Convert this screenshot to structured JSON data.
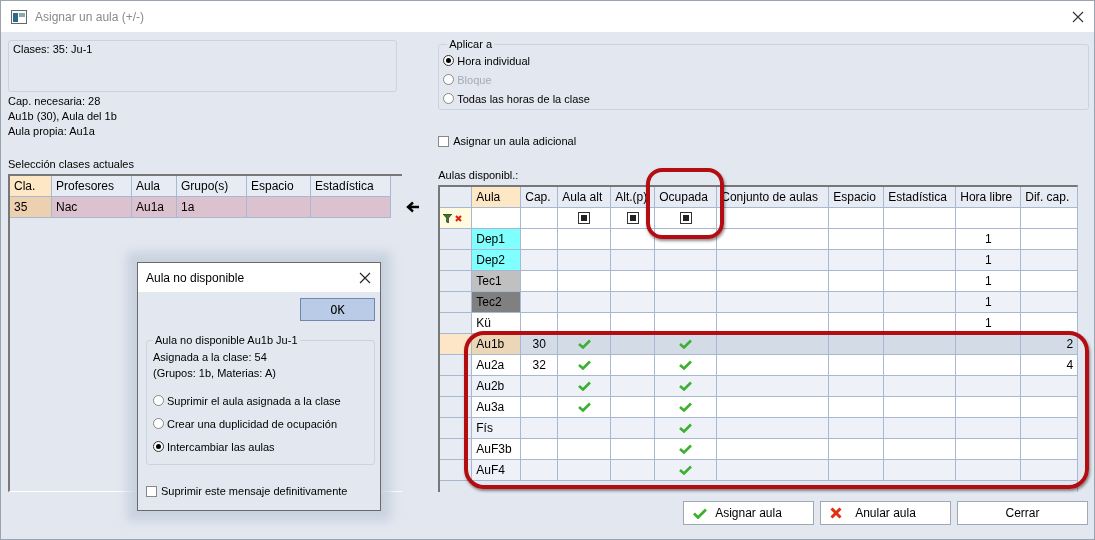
{
  "window": {
    "title": "Asignar un aula (+/-)"
  },
  "class_info": "Clases: 35: Ju-1",
  "info_lines": [
    "Cap. necesaria: 28",
    "Au1b (30), Aula del 1b",
    "Aula propia: Au1a"
  ],
  "current_classes": {
    "label": "Selección clases actuales",
    "columns": [
      "Cla.",
      "Profesores",
      "Aula",
      "Grupo(s)",
      "Espacio",
      "Estadística"
    ],
    "rows": [
      {
        "selected": true,
        "cells": [
          "35",
          "Nac",
          "Au1a",
          "1a",
          null,
          null
        ]
      }
    ]
  },
  "apply_to": {
    "legend": "Aplicar a",
    "options": [
      {
        "label": "Hora individual",
        "selected": true,
        "disabled": false
      },
      {
        "label": "Bloque",
        "selected": false,
        "disabled": true
      },
      {
        "label": "Todas las horas de la clase",
        "selected": false,
        "disabled": false
      }
    ]
  },
  "extra_room": {
    "label": "Asignar un aula adicional",
    "checked": false
  },
  "available_rooms": {
    "label": "Aulas disponibl.:",
    "columns": [
      {
        "label": "Aula",
        "kind": "text"
      },
      {
        "label": "Cap.",
        "kind": "center"
      },
      {
        "label": "Aula alt",
        "kind": "check",
        "filter_box": true
      },
      {
        "label": "Alt.(p)",
        "kind": "check",
        "filter_box": true
      },
      {
        "label": "Ocupada",
        "kind": "check",
        "filter_box": true
      },
      {
        "label": "Conjunto de aulas",
        "kind": "text"
      },
      {
        "label": "Espacio",
        "kind": "text"
      },
      {
        "label": "Estadística",
        "kind": "text"
      },
      {
        "label": "Hora libre",
        "kind": "center"
      },
      {
        "label": "Dif. cap.",
        "kind": "right"
      }
    ],
    "rows": [
      {
        "selected": false,
        "color": "#80ffff",
        "cells": [
          "Dep1",
          null,
          false,
          false,
          false,
          null,
          null,
          null,
          "1",
          null
        ]
      },
      {
        "selected": false,
        "color": "#80ffff",
        "cells": [
          "Dep2",
          null,
          false,
          false,
          false,
          null,
          null,
          null,
          "1",
          null
        ]
      },
      {
        "selected": false,
        "color": "#c0c0c0",
        "cells": [
          "Tec1",
          null,
          false,
          false,
          false,
          null,
          null,
          null,
          "1",
          null
        ]
      },
      {
        "selected": false,
        "color": "#808080",
        "cells": [
          "Tec2",
          null,
          false,
          false,
          false,
          null,
          null,
          null,
          "1",
          null
        ]
      },
      {
        "selected": false,
        "cells": [
          "Kü",
          null,
          false,
          false,
          false,
          null,
          null,
          null,
          "1",
          null
        ]
      },
      {
        "selected": true,
        "cells": [
          "Au1b",
          "30",
          true,
          false,
          true,
          null,
          null,
          null,
          null,
          "2"
        ]
      },
      {
        "selected": false,
        "cells": [
          "Au2a",
          "32",
          true,
          false,
          true,
          null,
          null,
          null,
          null,
          "4"
        ]
      },
      {
        "selected": false,
        "cells": [
          "Au2b",
          null,
          true,
          false,
          true,
          null,
          null,
          null,
          null,
          null
        ]
      },
      {
        "selected": false,
        "cells": [
          "Au3a",
          null,
          true,
          false,
          true,
          null,
          null,
          null,
          null,
          null
        ]
      },
      {
        "selected": false,
        "cells": [
          "Fís",
          null,
          false,
          false,
          true,
          null,
          null,
          null,
          null,
          null
        ]
      },
      {
        "selected": false,
        "cells": [
          "AuF3b",
          null,
          false,
          false,
          true,
          null,
          null,
          null,
          null,
          null
        ]
      },
      {
        "selected": false,
        "cells": [
          "AuF4",
          null,
          false,
          false,
          true,
          null,
          null,
          null,
          null,
          null
        ]
      }
    ]
  },
  "buttons": [
    {
      "label": "Asignar aula",
      "kind": "ok"
    },
    {
      "label": "Anular aula",
      "kind": "cancel"
    },
    {
      "label": "Cerrar",
      "kind": "plain"
    }
  ],
  "dialog": {
    "title": "Aula no disponible",
    "ok": "OK",
    "legend": "Aula no disponible  Au1b  Ju-1",
    "lines": [
      "Asignada a la clase: 54",
      "(Grupos: 1b, Materias: A)"
    ],
    "options": [
      {
        "label": "Suprimir el aula asignada a la clase",
        "selected": false
      },
      {
        "label": "Crear una duplicidad de ocupación",
        "selected": false
      },
      {
        "label": "Intercambiar las aulas",
        "selected": true
      }
    ],
    "suppress": {
      "label": "Suprimir este mensaje definitivamente",
      "checked": false
    }
  }
}
